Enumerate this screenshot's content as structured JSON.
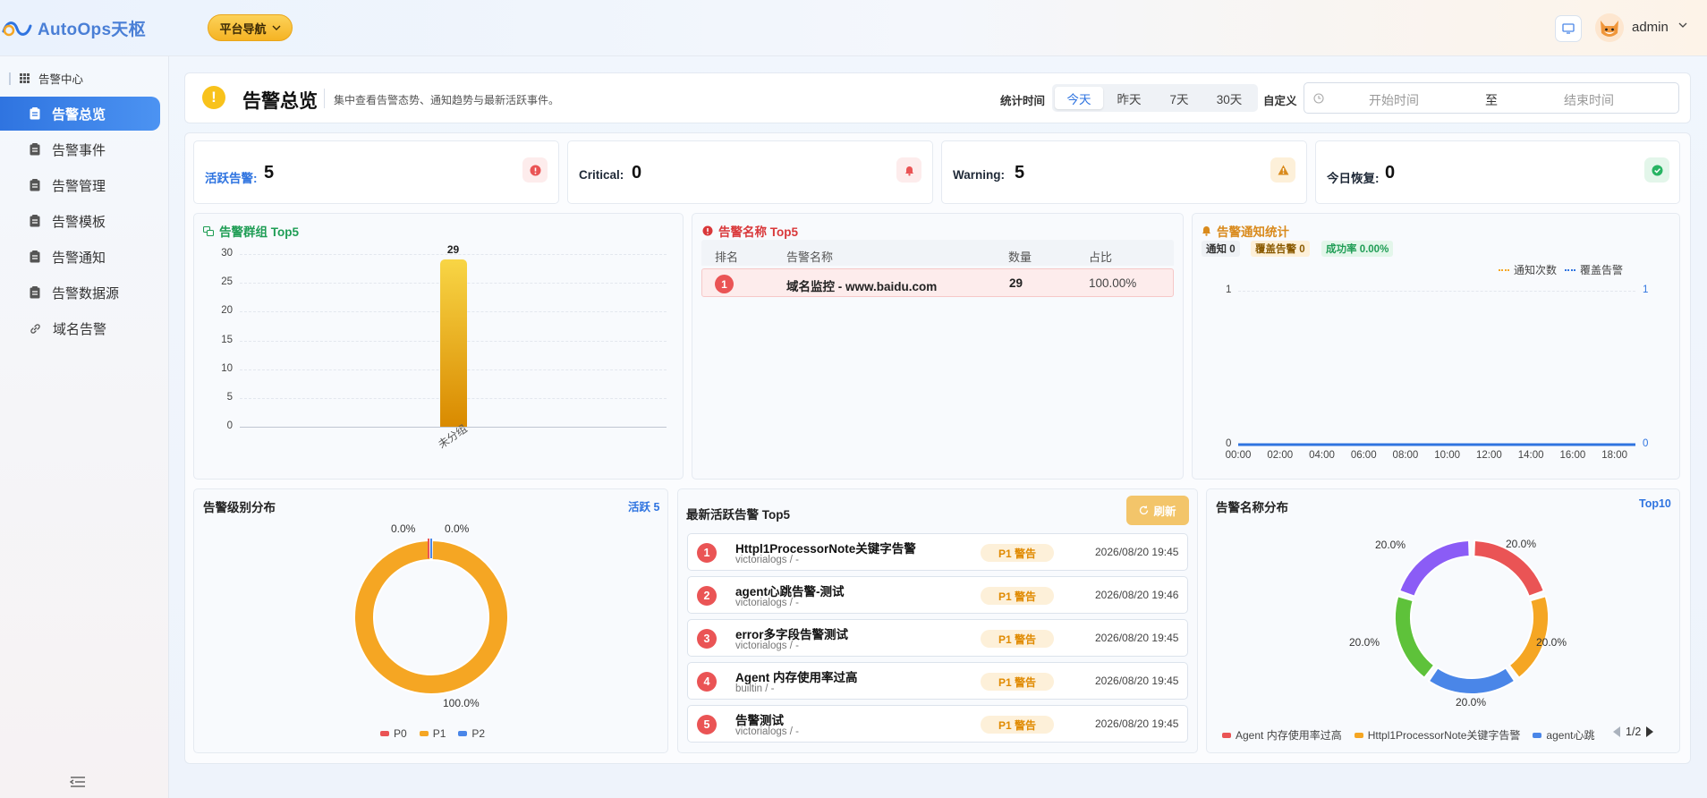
{
  "app": {
    "name": "AutoOps天枢",
    "nav_button": "平台导航",
    "user": "admin"
  },
  "sidebar": {
    "group": "告警中心",
    "items": [
      {
        "label": "告警总览",
        "active": true,
        "icon": "clipboard-icon"
      },
      {
        "label": "告警事件",
        "icon": "clipboard-icon"
      },
      {
        "label": "告警管理",
        "icon": "clipboard-icon"
      },
      {
        "label": "告警模板",
        "icon": "clipboard-icon"
      },
      {
        "label": "告警通知",
        "icon": "clipboard-icon"
      },
      {
        "label": "告警数据源",
        "icon": "clipboard-icon"
      },
      {
        "label": "域名告警",
        "icon": "link-icon"
      }
    ]
  },
  "header": {
    "title": "告警总览",
    "description": "集中查看告警态势、通知趋势与最新活跃事件。",
    "time_label": "统计时间",
    "time_options": [
      "今天",
      "昨天",
      "7天",
      "30天"
    ],
    "time_selected": "今天",
    "custom_label": "自定义",
    "start_placeholder": "开始时间",
    "range_sep": "至",
    "end_placeholder": "结束时间"
  },
  "stats": [
    {
      "label": "活跃告警:",
      "value": "5",
      "color": "#2f74e0",
      "icon": "alert-circle-icon",
      "icon_color": "#ea5455",
      "icon_bg": "#fdecec"
    },
    {
      "label": "Critical:",
      "value": "0",
      "color": "#111111",
      "icon": "bell-icon",
      "icon_color": "#ea5455",
      "icon_bg": "#fdecec"
    },
    {
      "label": "Warning:",
      "value": "5",
      "color": "#111111",
      "icon": "warning-icon",
      "icon_color": "#d98a1c",
      "icon_bg": "#fdf0d9"
    },
    {
      "label": "今日恢复:",
      "value": "0",
      "color": "#111111",
      "icon": "check-circle-icon",
      "icon_color": "#28b463",
      "icon_bg": "#e3f6ea"
    }
  ],
  "panels": {
    "group_top5": "告警群组 Top5",
    "name_top5": "告警名称 Top5",
    "notify_stats": "告警通知统计",
    "level_dist": "告警级别分布",
    "level_active": "活跃 5",
    "latest_alerts": "最新活跃告警 Top5",
    "refresh": "刷新",
    "name_dist": "告警名称分布",
    "name_dist_badge": "Top10"
  },
  "name_table": {
    "headers": [
      "排名",
      "告警名称",
      "数量",
      "占比"
    ],
    "rows": [
      {
        "rank": "1",
        "name": "域名监控 - www.baidu.com",
        "count": "29",
        "ratio": "100.00%"
      }
    ]
  },
  "notify": {
    "pills": [
      "通知 0",
      "覆盖告警 0",
      "成功率 0.00%"
    ]
  },
  "alerts": [
    {
      "rank": "1",
      "title": "Httpl1ProcessorNote关键字告警",
      "source": "victorialogs / -",
      "level": "P1 警告",
      "time": "2026/08/20 19:45"
    },
    {
      "rank": "2",
      "title": "agent心跳告警-测试",
      "source": "victorialogs / -",
      "level": "P1 警告",
      "time": "2026/08/20 19:46"
    },
    {
      "rank": "3",
      "title": "error多字段告警测试",
      "source": "victorialogs / -",
      "level": "P1 警告",
      "time": "2026/08/20 19:45"
    },
    {
      "rank": "4",
      "title": "Agent 内存使用率过高",
      "source": "builtin / -",
      "level": "P1 警告",
      "time": "2026/08/20 19:45"
    },
    {
      "rank": "5",
      "title": "告警测试",
      "source": "victorialogs / -",
      "level": "P1 警告",
      "time": "2026/08/20 19:45"
    }
  ],
  "chart_data": [
    {
      "type": "bar",
      "title": "告警群组 Top5",
      "categories": [
        "未分组"
      ],
      "values": [
        29
      ],
      "data_labels": [
        "29"
      ],
      "ylim": [
        0,
        30
      ],
      "yticks": [
        "30",
        "25",
        "20",
        "15",
        "10",
        "5",
        "0"
      ],
      "grid": true,
      "color": "#f1b21c"
    },
    {
      "type": "line",
      "title": "告警通知统计",
      "x": [
        "00:00",
        "02:00",
        "04:00",
        "06:00",
        "08:00",
        "10:00",
        "12:00",
        "14:00",
        "16:00",
        "18:00"
      ],
      "series": [
        {
          "name": "通知次数",
          "values": [
            0,
            0,
            0,
            0,
            0,
            0,
            0,
            0,
            0,
            0
          ],
          "color": "#f5a623"
        },
        {
          "name": "覆盖告警",
          "values": [
            0,
            0,
            0,
            0,
            0,
            0,
            0,
            0,
            0,
            0
          ],
          "color": "#2f74e0"
        }
      ],
      "ylim": [
        0,
        1
      ],
      "yticks_left": [
        "1",
        "0"
      ],
      "yticks_right": [
        "1",
        "0"
      ],
      "legend": "top-right"
    },
    {
      "type": "pie",
      "title": "告警级别分布",
      "labels": [
        "P0",
        "P1",
        "P2"
      ],
      "values": [
        0,
        5,
        0
      ],
      "percent_labels": [
        "0.0%",
        "100.0%",
        "0.0%"
      ],
      "colors": [
        "#ea5455",
        "#f5a623",
        "#4a86e8"
      ],
      "legend": "bottom"
    },
    {
      "type": "pie",
      "title": "告警名称分布",
      "labels": [
        "Agent 内存使用率过高",
        "Httpl1ProcessorNote关键字告警",
        "agent心跳"
      ],
      "values": [
        20,
        20,
        20,
        20,
        20
      ],
      "percent_labels": [
        "20.0%",
        "20.0%",
        "20.0%",
        "20.0%",
        "20.0%"
      ],
      "colors": [
        "#ea5455",
        "#f5a623",
        "#4a86e8",
        "#5ec23a",
        "#8b5cf6"
      ],
      "legend": "bottom",
      "page": "1/2"
    }
  ]
}
